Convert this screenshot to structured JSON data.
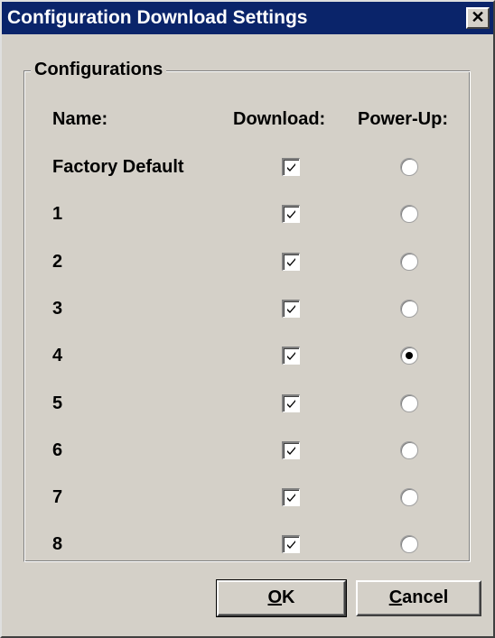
{
  "window": {
    "title": "Configuration Download Settings",
    "close_glyph": "✕",
    "colors": {
      "titlebar": "#0a246a",
      "face": "#d4d0c8"
    }
  },
  "group": {
    "legend": "Configurations",
    "headers": {
      "name": "Name:",
      "download": "Download:",
      "powerup": "Power-Up:"
    },
    "rows": [
      {
        "name": "Factory Default",
        "download": true,
        "powerup": false
      },
      {
        "name": "1",
        "download": true,
        "powerup": false
      },
      {
        "name": "2",
        "download": true,
        "powerup": false
      },
      {
        "name": "3",
        "download": true,
        "powerup": false
      },
      {
        "name": "4",
        "download": true,
        "powerup": true
      },
      {
        "name": "5",
        "download": true,
        "powerup": false
      },
      {
        "name": "6",
        "download": true,
        "powerup": false
      },
      {
        "name": "7",
        "download": true,
        "powerup": false
      },
      {
        "name": "8",
        "download": true,
        "powerup": false
      }
    ]
  },
  "buttons": {
    "ok": {
      "mnemonic": "O",
      "rest": "K"
    },
    "cancel": {
      "mnemonic": "C",
      "rest": "ancel"
    }
  }
}
